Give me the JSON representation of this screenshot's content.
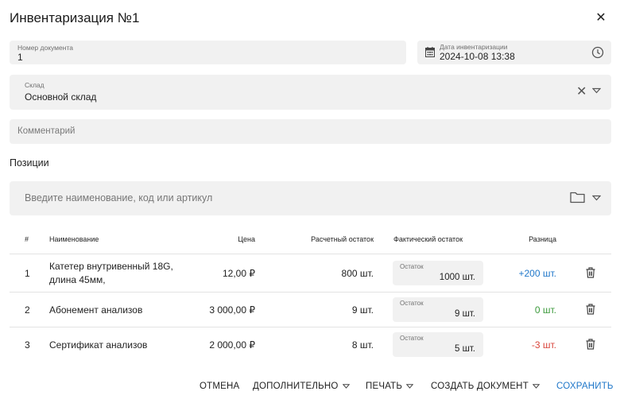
{
  "dialog": {
    "title": "Инвентаризация №1",
    "close_icon": "close-icon",
    "close_glyph": "✕"
  },
  "form": {
    "doc_number": {
      "label": "Номер документа",
      "value": "1"
    },
    "doc_date": {
      "label": "Дата инвентаризации",
      "value": "2024-10-08 13:38",
      "icon": "calendar-icon",
      "trailing_icon": "clock-icon"
    },
    "warehouse": {
      "label": "Склад",
      "value": "Основной склад",
      "clear_glyph": "✕"
    },
    "comment": {
      "placeholder": "Комментарий"
    }
  },
  "positions": {
    "title": "Позиции",
    "search_placeholder": "Введите наименование, код или артикул",
    "columns": {
      "num": "#",
      "name": "Наименование",
      "price": "Цена",
      "calc": "Расчетный остаток",
      "fact": "Фактический остаток",
      "diff": "Разница"
    },
    "fact_label": "Остаток",
    "rows": [
      {
        "num": "1",
        "name": "Катетер внутривенный 18G, длина 45мм,",
        "price": "12,00 ₽",
        "calc": "800 шт.",
        "fact": "1000 шт.",
        "diff": "+200 шт.",
        "diff_color": "#1f77c9"
      },
      {
        "num": "2",
        "name": "Абонемент анализов",
        "price": "3 000,00 ₽",
        "calc": "9 шт.",
        "fact": "9 шт.",
        "diff": "0 шт.",
        "diff_color": "#3c9a3c"
      },
      {
        "num": "3",
        "name": "Сертификат анализов",
        "price": "2 000,00 ₽",
        "calc": "8 шт.",
        "fact": "5 шт.",
        "diff": "-3 шт.",
        "diff_color": "#d9453b"
      }
    ]
  },
  "footer": {
    "cancel": "ОТМЕНА",
    "more": "ДОПОЛНИТЕЛЬНО",
    "print": "ПЕЧАТЬ",
    "create_doc": "СОЗДАТЬ ДОКУМЕНТ",
    "save": "СОХРАНИТЬ",
    "accent": "#1f77c9"
  }
}
